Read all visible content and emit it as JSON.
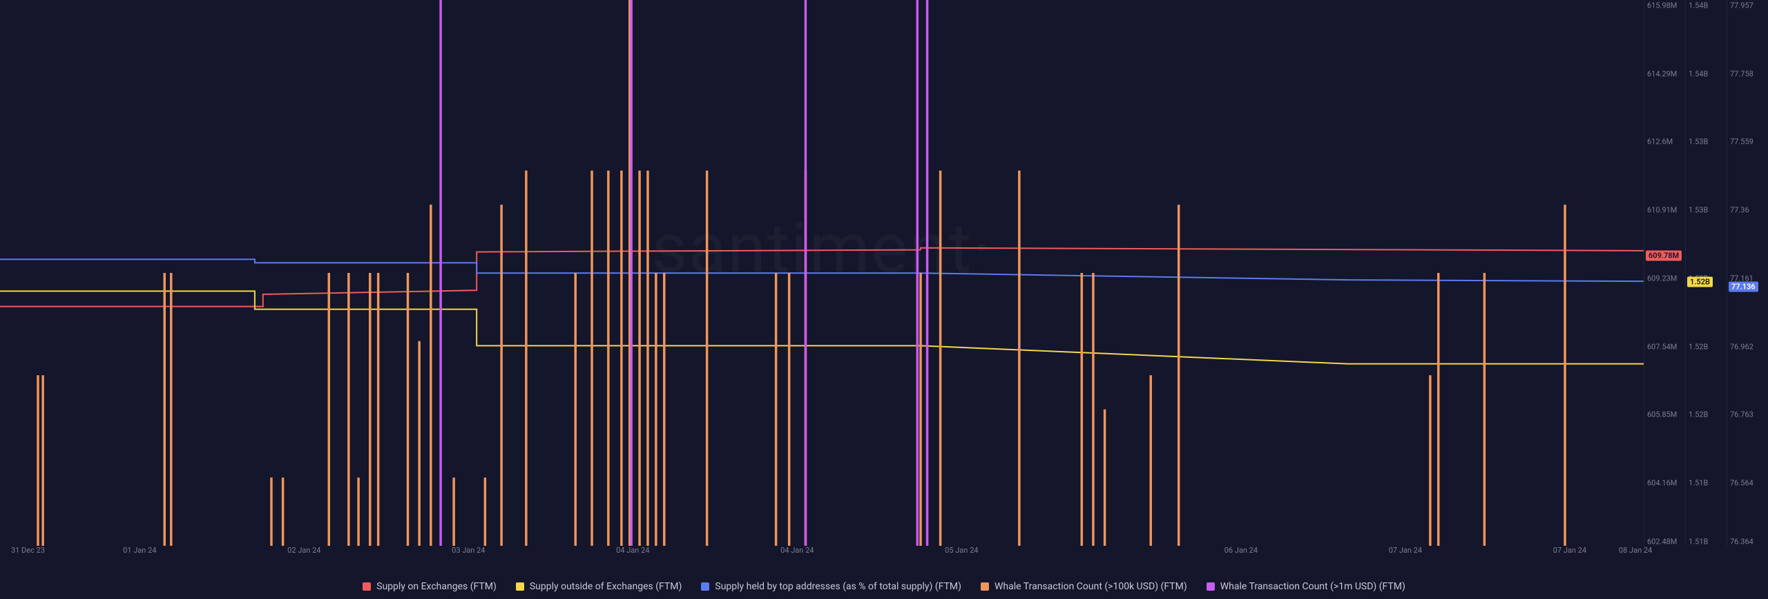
{
  "watermark": "santiment·",
  "legend": [
    {
      "color": "#f05b5b",
      "label": "Supply on Exchanges (FTM)"
    },
    {
      "color": "#f3d74a",
      "label": "Supply outside of Exchanges (FTM)"
    },
    {
      "color": "#5b7bf0",
      "label": "Supply held by top addresses (as % of total supply) (FTM)"
    },
    {
      "color": "#f0955b",
      "label": "Whale Transaction Count (>100k USD) (FTM)"
    },
    {
      "color": "#c85bf0",
      "label": "Whale Transaction Count (>1m USD) (FTM)"
    }
  ],
  "x_axis": {
    "ticks": [
      {
        "label": "31 Dec 23",
        "pos": 0.017
      },
      {
        "label": "01 Jan 24",
        "pos": 0.085
      },
      {
        "label": "02 Jan 24",
        "pos": 0.185
      },
      {
        "label": "03 Jan 24",
        "pos": 0.285
      },
      {
        "label": "04 Jan 24",
        "pos": 0.385
      },
      {
        "label": "04 Jan 24",
        "pos": 0.485
      },
      {
        "label": "05 Jan 24",
        "pos": 0.585
      },
      {
        "label": "06 Jan 24",
        "pos": 0.755
      },
      {
        "label": "07 Jan 24",
        "pos": 0.855
      },
      {
        "label": "07 Jan 24",
        "pos": 0.955
      },
      {
        "label": "08 Jan 24",
        "pos": 0.995
      }
    ]
  },
  "y_axes": [
    {
      "name": "supply_exchange_M",
      "ticks": [
        {
          "label": "615.98M",
          "pos": 0.01
        },
        {
          "label": "614.29M",
          "pos": 0.135
        },
        {
          "label": "612.6M",
          "pos": 0.26
        },
        {
          "label": "610.91M",
          "pos": 0.385
        },
        {
          "label": "609.23M",
          "pos": 0.51
        },
        {
          "label": "607.54M",
          "pos": 0.635
        },
        {
          "label": "605.85M",
          "pos": 0.76
        },
        {
          "label": "604.16M",
          "pos": 0.885
        },
        {
          "label": "602.48M",
          "pos": 0.992
        }
      ],
      "current_badge": {
        "label": "609.78M",
        "pos": 0.468,
        "bg": "#f05b5b",
        "fg": "#14162b"
      }
    },
    {
      "name": "supply_outside_B",
      "ticks": [
        {
          "label": "1.54B",
          "pos": 0.01
        },
        {
          "label": "1.54B",
          "pos": 0.135
        },
        {
          "label": "1.53B",
          "pos": 0.26
        },
        {
          "label": "1.53B",
          "pos": 0.385
        },
        {
          "label": "1.52B",
          "pos": 0.51
        },
        {
          "label": "1.52B",
          "pos": 0.635
        },
        {
          "label": "1.52B",
          "pos": 0.76
        },
        {
          "label": "1.51B",
          "pos": 0.885
        },
        {
          "label": "1.51B",
          "pos": 0.992
        }
      ],
      "current_badge": {
        "label": "1.52B",
        "pos": 0.517,
        "bg": "#f3d74a",
        "fg": "#14162b"
      }
    },
    {
      "name": "supply_top_pct",
      "ticks": [
        {
          "label": "77.957",
          "pos": 0.01
        },
        {
          "label": "77.758",
          "pos": 0.135
        },
        {
          "label": "77.559",
          "pos": 0.26
        },
        {
          "label": "77.36",
          "pos": 0.385
        },
        {
          "label": "77.161",
          "pos": 0.51
        },
        {
          "label": "76.962",
          "pos": 0.635
        },
        {
          "label": "76.763",
          "pos": 0.76
        },
        {
          "label": "76.564",
          "pos": 0.885
        },
        {
          "label": "76.364",
          "pos": 0.992
        }
      ],
      "current_badge": {
        "label": "77.136",
        "pos": 0.525,
        "bg": "#5b7bf0",
        "fg": "#ffffff"
      }
    }
  ],
  "chart_data": {
    "type": "line",
    "x_domain": [
      "31 Dec 23",
      "08 Jan 24"
    ],
    "series": [
      {
        "name": "Supply on Exchanges (FTM)",
        "color": "#f05b5b",
        "unit": "M",
        "y_range": [
          602.48,
          615.98
        ],
        "points": [
          {
            "x": 0.0,
            "y": 608.4
          },
          {
            "x": 0.16,
            "y": 608.4
          },
          {
            "x": 0.16,
            "y": 608.7
          },
          {
            "x": 0.29,
            "y": 608.8
          },
          {
            "x": 0.29,
            "y": 609.75
          },
          {
            "x": 0.56,
            "y": 609.8
          },
          {
            "x": 0.56,
            "y": 609.85
          },
          {
            "x": 1.0,
            "y": 609.78
          }
        ],
        "current": 609.78
      },
      {
        "name": "Supply outside of Exchanges (FTM)",
        "color": "#f3d74a",
        "unit": "B",
        "y_range": [
          1.51,
          1.54
        ],
        "points": [
          {
            "x": 0.0,
            "y": 1.524
          },
          {
            "x": 0.155,
            "y": 1.524
          },
          {
            "x": 0.155,
            "y": 1.523
          },
          {
            "x": 0.29,
            "y": 1.523
          },
          {
            "x": 0.29,
            "y": 1.521
          },
          {
            "x": 0.56,
            "y": 1.521
          },
          {
            "x": 0.82,
            "y": 1.52
          },
          {
            "x": 1.0,
            "y": 1.52
          }
        ],
        "current": 1.52
      },
      {
        "name": "Supply held by top addresses (as % of total supply) (FTM)",
        "color": "#5b7bf0",
        "unit": "%",
        "y_range": [
          76.364,
          77.957
        ],
        "points": [
          {
            "x": 0.0,
            "y": 77.2
          },
          {
            "x": 0.155,
            "y": 77.2
          },
          {
            "x": 0.155,
            "y": 77.19
          },
          {
            "x": 0.29,
            "y": 77.19
          },
          {
            "x": 0.29,
            "y": 77.16
          },
          {
            "x": 0.56,
            "y": 77.16
          },
          {
            "x": 0.82,
            "y": 77.14
          },
          {
            "x": 1.0,
            "y": 77.136
          }
        ],
        "current": 77.136
      },
      {
        "name": "Whale Transaction Count (>100k USD) (FTM)",
        "color": "#f0955b",
        "type": "bar",
        "y_range": [
          0,
          8
        ],
        "bars": [
          {
            "x": 0.023,
            "v": 2.5
          },
          {
            "x": 0.026,
            "v": 2.5
          },
          {
            "x": 0.1,
            "v": 4
          },
          {
            "x": 0.104,
            "v": 4
          },
          {
            "x": 0.165,
            "v": 1
          },
          {
            "x": 0.172,
            "v": 1
          },
          {
            "x": 0.2,
            "v": 4
          },
          {
            "x": 0.212,
            "v": 4
          },
          {
            "x": 0.218,
            "v": 1
          },
          {
            "x": 0.225,
            "v": 4
          },
          {
            "x": 0.23,
            "v": 4
          },
          {
            "x": 0.248,
            "v": 4
          },
          {
            "x": 0.255,
            "v": 3
          },
          {
            "x": 0.262,
            "v": 5
          },
          {
            "x": 0.276,
            "v": 1
          },
          {
            "x": 0.295,
            "v": 1
          },
          {
            "x": 0.305,
            "v": 5
          },
          {
            "x": 0.32,
            "v": 5.5
          },
          {
            "x": 0.35,
            "v": 4
          },
          {
            "x": 0.36,
            "v": 5.5
          },
          {
            "x": 0.37,
            "v": 5.5
          },
          {
            "x": 0.378,
            "v": 5.5
          },
          {
            "x": 0.383,
            "v": 8
          },
          {
            "x": 0.389,
            "v": 5.5
          },
          {
            "x": 0.394,
            "v": 5.5
          },
          {
            "x": 0.399,
            "v": 4
          },
          {
            "x": 0.404,
            "v": 4
          },
          {
            "x": 0.43,
            "v": 5.5
          },
          {
            "x": 0.472,
            "v": 4
          },
          {
            "x": 0.48,
            "v": 4
          },
          {
            "x": 0.49,
            "v": 5.5
          },
          {
            "x": 0.56,
            "v": 4
          },
          {
            "x": 0.572,
            "v": 5.5
          },
          {
            "x": 0.62,
            "v": 5.5
          },
          {
            "x": 0.658,
            "v": 4
          },
          {
            "x": 0.665,
            "v": 4
          },
          {
            "x": 0.672,
            "v": 2
          },
          {
            "x": 0.7,
            "v": 2.5
          },
          {
            "x": 0.717,
            "v": 5
          },
          {
            "x": 0.87,
            "v": 2.5
          },
          {
            "x": 0.875,
            "v": 4
          },
          {
            "x": 0.903,
            "v": 4
          },
          {
            "x": 0.952,
            "v": 5
          }
        ]
      },
      {
        "name": "Whale Transaction Count (>1m USD) (FTM)",
        "color": "#c85bf0",
        "type": "bar",
        "y_range": [
          0,
          1
        ],
        "bars": [
          {
            "x": 0.268,
            "v": 1
          },
          {
            "x": 0.384,
            "v": 1
          },
          {
            "x": 0.49,
            "v": 1
          },
          {
            "x": 0.558,
            "v": 1
          },
          {
            "x": 0.564,
            "v": 1
          }
        ]
      }
    ]
  }
}
